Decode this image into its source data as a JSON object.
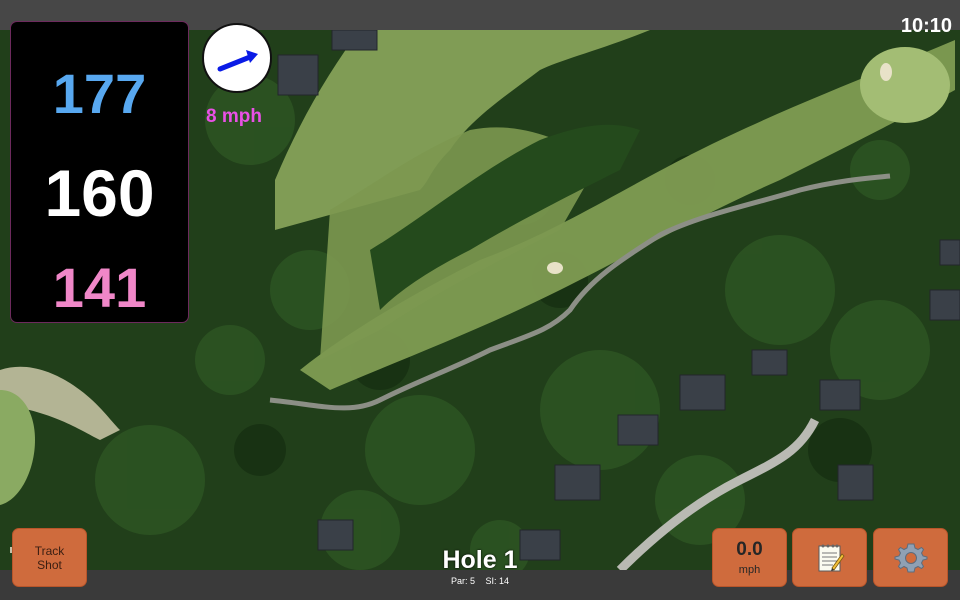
{
  "status_bar": {
    "time": "10:10"
  },
  "distances": {
    "back": "177",
    "center": "160",
    "front": "141"
  },
  "colors": {
    "back": "#58a8f0",
    "center": "#ffffff",
    "front": "#f087c8",
    "wind_text": "#ea50e6",
    "button": "#cf6b3d"
  },
  "wind": {
    "speed_label": "8 mph",
    "arrow_icon": "wind-direction-arrow-icon"
  },
  "buttons": {
    "track_shot_line1": "Track",
    "track_shot_line2": "Shot",
    "wind_value": "0.0",
    "wind_unit": "mph",
    "notes_icon": "notepad-icon",
    "settings_icon": "gear-icon"
  },
  "hole": {
    "title": "Hole 1",
    "par": "Par: 5",
    "stroke_index": "SI: 14"
  }
}
